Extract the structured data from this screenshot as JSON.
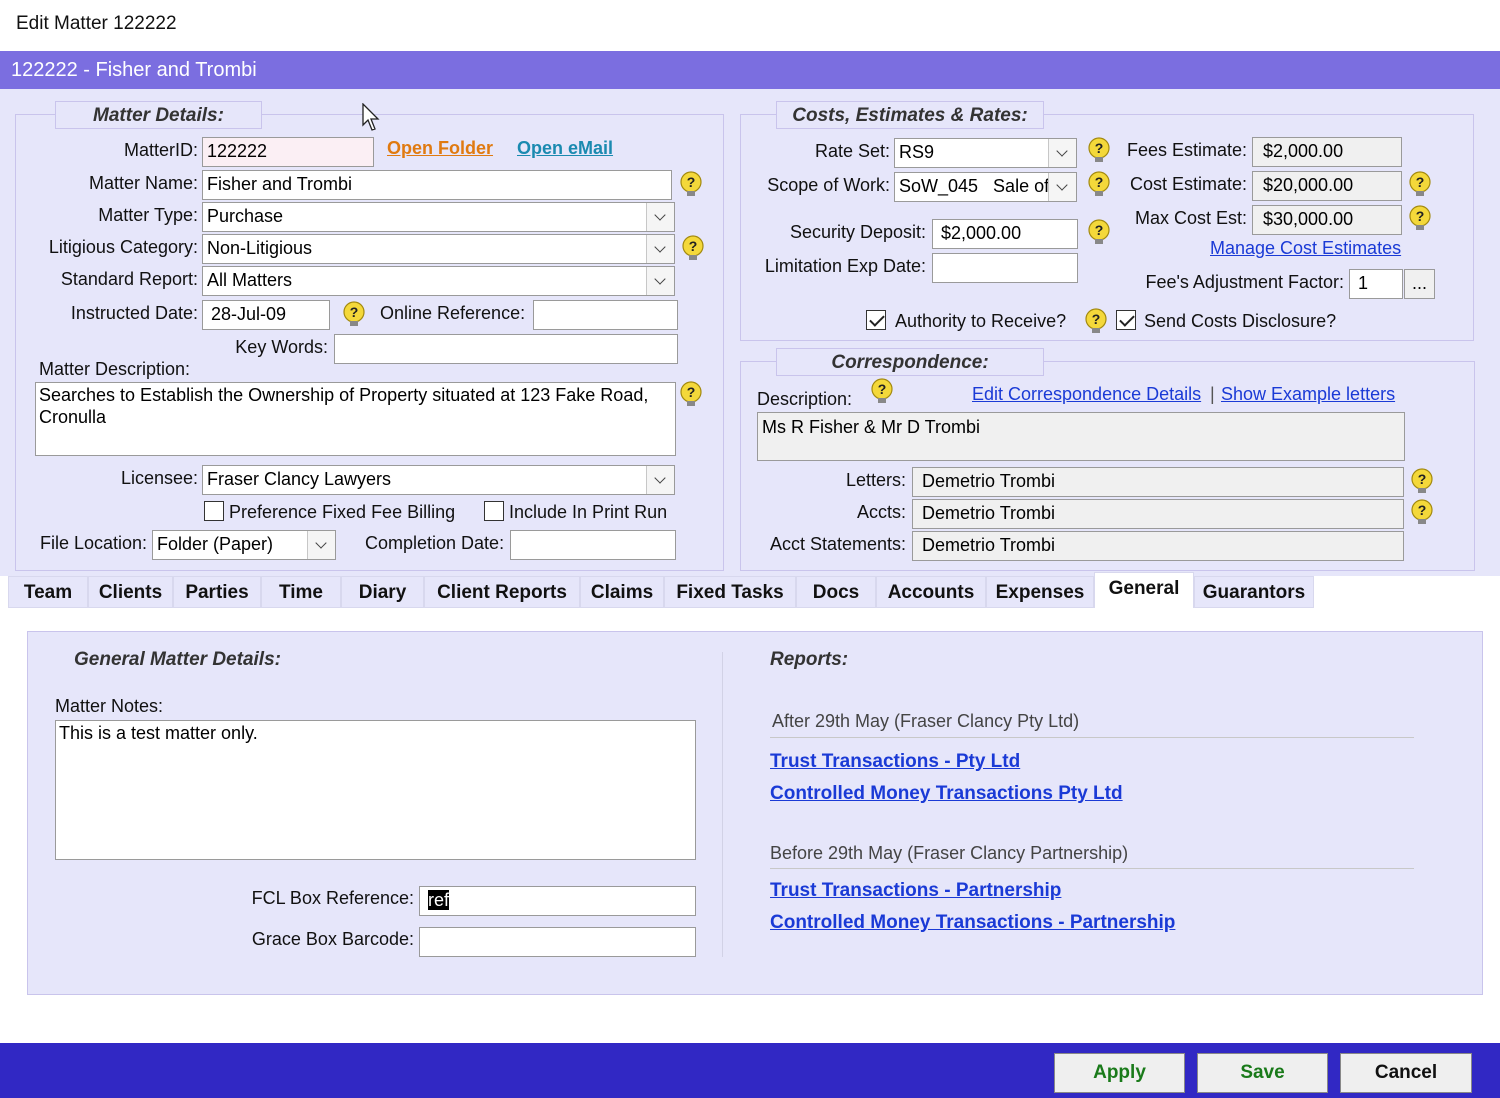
{
  "window": {
    "title": "Edit Matter 122222",
    "header": "122222 - Fisher and Trombi"
  },
  "colors": {
    "header_bar": "#7b6ee0",
    "panel_bg": "#e6e6fa",
    "footer_bar": "#3128c4",
    "apply_text": "#1a7a1a",
    "open_folder_link": "#e07a10",
    "open_email_link": "#1a8ab0",
    "report_link": "#1a3ad6"
  },
  "icons": {
    "help": "question-bulb-icon",
    "dropdown": "chevron-down-icon",
    "cursor": "mouse-pointer-icon"
  },
  "matter": {
    "legend": "Matter Details:",
    "matter_id_label": "MatterID:",
    "matter_id": "122222",
    "open_folder": "Open Folder",
    "open_email": "Open eMail",
    "matter_name_label": "Matter Name:",
    "matter_name": "Fisher and Trombi",
    "matter_type_label": "Matter Type:",
    "matter_type": "Purchase",
    "litigious_label": "Litigious Category:",
    "litigious": "Non-Litigious",
    "standard_report_label": "Standard Report:",
    "standard_report": "All Matters",
    "instructed_label": "Instructed Date:",
    "instructed": "28-Jul-09",
    "online_ref_label": "Online Reference:",
    "online_ref": "",
    "keywords_label": "Key Words:",
    "keywords": "",
    "description_label": "Matter Description:",
    "description": "Searches to Establish the Ownership of Property situated at 123 Fake Road, Cronulla",
    "licensee_label": "Licensee:",
    "licensee": "Fraser Clancy Lawyers",
    "pref_fixed_fee": "Preference Fixed Fee Billing",
    "include_print_run": "Include In Print Run",
    "file_location_label": "File Location:",
    "file_location": "Folder (Paper)",
    "completion_label": "Completion Date:",
    "completion": ""
  },
  "costs": {
    "legend": "Costs, Estimates & Rates:",
    "rate_set_label": "Rate Set:",
    "rate_set": "RS9",
    "scope_label": "Scope of Work:",
    "scope": "SoW_045   Sale of",
    "security_label": "Security Deposit:",
    "security": "$2,000.00",
    "limitation_label": "Limitation Exp Date:",
    "limitation": "",
    "fees_est_label": "Fees Estimate:",
    "fees_est": "$2,000.00",
    "cost_est_label": "Cost Estimate:",
    "cost_est": "$20,000.00",
    "max_cost_label": "Max Cost Est:",
    "max_cost": "$30,000.00",
    "manage_link": "Manage Cost Estimates",
    "adj_label": "Fee's Adjustment Factor:",
    "adj": "1",
    "adj_btn": "...",
    "authority": "Authority to Receive?",
    "send_costs": "Send Costs Disclosure?"
  },
  "corr": {
    "legend": "Correspondence:",
    "description_label": "Description:",
    "edit_link": "Edit Correspondence Details",
    "sep": "|",
    "example_link": "Show Example letters",
    "description": "Ms R Fisher & Mr D Trombi",
    "letters_label": "Letters:",
    "letters": "Demetrio Trombi",
    "accts_label": "Accts:",
    "accts": "Demetrio Trombi",
    "acct_statements_label": "Acct Statements:",
    "acct_statements": "Demetrio Trombi"
  },
  "tabs": [
    "Team",
    "Clients",
    "Parties",
    "Time",
    "Diary",
    "Client Reports",
    "Claims",
    "Fixed Tasks",
    "Docs",
    "Accounts",
    "Expenses",
    "General",
    "Guarantors"
  ],
  "general": {
    "title": "General Matter Details:",
    "notes_label": "Matter Notes:",
    "notes": "This is a test matter only.",
    "fcl_label": "FCL Box Reference:",
    "fcl": "ref",
    "grace_label": "Grace Box Barcode:",
    "grace": ""
  },
  "reports": {
    "title": "Reports:",
    "after_head": "After 29th May (Fraser Clancy Pty Ltd)",
    "after_links": [
      "Trust Transactions - Pty Ltd",
      "Controlled Money Transactions Pty Ltd"
    ],
    "before_head": "Before 29th May (Fraser Clancy Partnership)",
    "before_links": [
      "Trust Transactions - Partnership",
      "Controlled Money Transactions - Partnership"
    ]
  },
  "buttons": {
    "apply": "Apply",
    "save": "Save",
    "cancel": "Cancel"
  }
}
